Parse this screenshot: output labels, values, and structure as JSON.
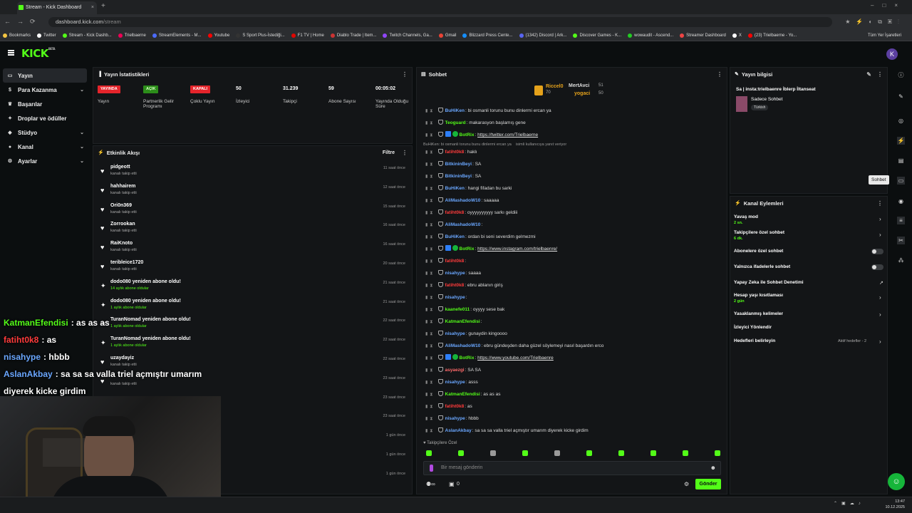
{
  "browser": {
    "tab_title": "Stream - Kick Dashboard",
    "url_domain": "dashboard.kick.com",
    "url_path": "/stream",
    "bookmarks": [
      "Bookmarks",
      "Twitter",
      "Stream - Kick Dashb...",
      "Trielbaerne",
      "StreamElements - M...",
      "Youtube",
      "S Sport Plus-İstediği...",
      "F1 TV | Home",
      "Diablo Trade | Item...",
      "Twitch Channels, Ga...",
      "Gmail",
      "Blizzard Press Cente...",
      "(1342) Discord | Ark...",
      "Discover Games - K...",
      "wowaudit - Ascend...",
      "Streamer Dashboard",
      "X",
      "(23) Trielbaerne - Yo..."
    ],
    "bookmarks_right": "Tüm Yer İşaretleri"
  },
  "app": {
    "logo": "KICK",
    "logo_sup": "BETA",
    "avatar": "K"
  },
  "sidebar": {
    "items": [
      {
        "label": "Yayın",
        "icon": "stream-icon"
      },
      {
        "label": "Para Kazanma",
        "icon": "dollar-icon"
      },
      {
        "label": "Başarılar",
        "icon": "trophy-icon"
      },
      {
        "label": "Droplar ve ödüller",
        "icon": "gift-icon"
      },
      {
        "label": "Stüdyo",
        "icon": "studio-icon"
      },
      {
        "label": "Kanal",
        "icon": "user-icon"
      },
      {
        "label": "Ayarlar",
        "icon": "gear-icon"
      }
    ]
  },
  "stats": {
    "title": "Yayın İstatistikleri",
    "items": [
      {
        "value": "YAYINDA",
        "label": "Yayın",
        "type": "badge-red"
      },
      {
        "value": "AÇIK",
        "label": "Partnerlik Gelir Programı",
        "type": "badge-green"
      },
      {
        "value": "KAPALI",
        "label": "Çoklu Yayın",
        "type": "badge-red"
      },
      {
        "value": "50",
        "label": "İzleyici"
      },
      {
        "value": "31.239",
        "label": "Takipçi"
      },
      {
        "value": "59",
        "label": "Abone Sayısı"
      },
      {
        "value": "00:05:02",
        "label": "Yayında Olduğu Süre"
      }
    ]
  },
  "events": {
    "title": "Etkinlik Akışı",
    "filter": "Filtre",
    "items": [
      {
        "name": "pidgeott",
        "sub": "kanalı takip etti",
        "time": "11 saat önce",
        "icon": "heart"
      },
      {
        "name": "hahhairem",
        "sub": "kanalı takip etti",
        "time": "12 saat önce",
        "icon": "heart"
      },
      {
        "name": "Ori0n369",
        "sub": "kanalı takip etti",
        "time": "15 saat önce",
        "icon": "heart"
      },
      {
        "name": "Zorrookan",
        "sub": "kanalı takip etti",
        "time": "16 saat önce",
        "icon": "heart"
      },
      {
        "name": "RaiKnoto",
        "sub": "kanalı takip etti",
        "time": "16 saat önce",
        "icon": "heart"
      },
      {
        "name": "teribleice1720",
        "sub": "kanalı takip etti",
        "time": "20 saat önce",
        "icon": "heart"
      },
      {
        "name": "dodo080 yeniden abone oldu!",
        "sub": "14 aylık abone oldular",
        "time": "21 saat önce",
        "icon": "star"
      },
      {
        "name": "dodo080 yeniden abone oldu!",
        "sub": "1 aylık abone oldular",
        "time": "21 saat önce",
        "icon": "star"
      },
      {
        "name": "TuranNomad yeniden abone oldu!",
        "sub": "1 aylık abone oldular",
        "time": "22 saat önce",
        "icon": "star"
      },
      {
        "name": "TuranNomad yeniden abone oldu!",
        "sub": "1 aylık abone oldular",
        "time": "22 saat önce",
        "icon": "star"
      },
      {
        "name": "uzaydayiz",
        "sub": "kanalı takip etti",
        "time": "22 saat önce",
        "icon": "heart"
      },
      {
        "name": "",
        "sub": "kanalı takip etti",
        "time": "23 saat önce",
        "icon": "heart"
      },
      {
        "name": "",
        "sub": "",
        "time": "23 saat önce",
        "icon": "star"
      },
      {
        "name": "",
        "sub": "",
        "time": "23 saat önce",
        "icon": "heart"
      },
      {
        "name": "",
        "sub": "",
        "time": "1 gün önce",
        "icon": "heart"
      },
      {
        "name": "",
        "sub": "",
        "time": "1 gün önce",
        "icon": "heart"
      },
      {
        "name": "",
        "sub": "",
        "time": "1 gün önce",
        "icon": "heart"
      }
    ]
  },
  "chat": {
    "title": "Sohbet",
    "top": [
      {
        "name": "Riccel0",
        "count": "70"
      },
      {
        "name": "MertAvci",
        "count": "51"
      },
      {
        "name": "yogaci",
        "count": "50"
      }
    ],
    "reply_hint": "BuHiKen: bi osmanli torunu bunu dinlermi ercan ya",
    "reply_hint_suffix": "isimli kullanıcıya yanıt veriyor",
    "messages": [
      {
        "user": "BuHiKen",
        "color": "#6aa7ff",
        "text": "bi osmanli torunu bunu dinlermi ercan ya"
      },
      {
        "user": "Teoguard",
        "color": "#53fc18",
        "text": "makarasyon başlamış gene"
      },
      {
        "user": "BotRix",
        "color": "#53fc18",
        "text": "",
        "link": "https://twitter.com/Trielbaerne",
        "bot": true
      },
      {
        "user": "fatiht0k8",
        "color": "#ff3b3b",
        "text": "haklı"
      },
      {
        "user": "BitkininBeyi",
        "color": "#6aa7ff",
        "text": "SA"
      },
      {
        "user": "BitkininBeyi",
        "color": "#6aa7ff",
        "text": "SA"
      },
      {
        "user": "BuHiKen",
        "color": "#6aa7ff",
        "text": "hangi fifadan bu sarki"
      },
      {
        "user": "AliMashadoW10",
        "color": "#6aa7ff",
        "text": "saaaaa"
      },
      {
        "user": "fatiht0k8",
        "color": "#ff3b3b",
        "text": "oyyyyyyyyyy sarkı geldiii"
      },
      {
        "user": "AliMashadoW10",
        "color": "#6aa7ff",
        "text": ""
      },
      {
        "user": "BuHiKen",
        "color": "#6aa7ff",
        "text": "ordan bi seni severdim gelmezmi"
      },
      {
        "user": "BotRix",
        "color": "#53fc18",
        "text": "",
        "link": "https://www.instagram.com/trielbaenre/",
        "bot": true
      },
      {
        "user": "fatiht0k8",
        "color": "#ff3b3b",
        "text": ""
      },
      {
        "user": "nisahype",
        "color": "#6aa7ff",
        "text": "saaaa"
      },
      {
        "user": "fatiht0k8",
        "color": "#ff3b3b",
        "text": "ebru ablanın giriş"
      },
      {
        "user": "nisahype",
        "color": "#6aa7ff",
        "text": ""
      },
      {
        "user": "kaanefe011",
        "color": "#53fc18",
        "text": "oyyyy sese bak"
      },
      {
        "user": "KatmanEfendisi",
        "color": "#53fc18",
        "text": ""
      },
      {
        "user": "nisahype",
        "color": "#6aa7ff",
        "text": "gunaydin kingoooo"
      },
      {
        "user": "AliMashadoW10",
        "color": "#6aa7ff",
        "text": "ebru gündeşden daha güzel söylemeyi nasıl başardın erco"
      },
      {
        "user": "BotRix",
        "color": "#53fc18",
        "text": "",
        "link": "https://www.youtube.com/Trielbaenre",
        "bot": true
      },
      {
        "user": "asyaezgi",
        "color": "#ff6a6a",
        "text": "SA SA"
      },
      {
        "user": "nisahype",
        "color": "#6aa7ff",
        "text": "asss"
      },
      {
        "user": "KatmanEfendisi",
        "color": "#53fc18",
        "text": "as as as"
      },
      {
        "user": "fatiht0k8",
        "color": "#ff3b3b",
        "text": "as"
      },
      {
        "user": "nisahype",
        "color": "#6aa7ff",
        "text": "hbbb"
      },
      {
        "user": "AslanAkbay",
        "color": "#6aa7ff",
        "text": "sa sa sa valla triel açmıştır umarım diyerek kicke girdim"
      }
    ],
    "followers_only": "Takipçilere Özel",
    "input_placeholder": "Bir mesaj gönderin",
    "send": "Gönder",
    "viewer_count": "0"
  },
  "info": {
    "title": "Yayın bilgisi",
    "stream_title": "Sa | insta:trielbaenre İblerp İltanseat",
    "category": "Sadece Sohbet",
    "tag": "Türkish"
  },
  "actions": {
    "title": "Kanal Eylemleri",
    "items": [
      {
        "label": "Yavaş mod",
        "sub": "2 sn.",
        "ctrl": "chevron"
      },
      {
        "label": "Takipçilere özel sohbet",
        "sub": "6 dk.",
        "ctrl": "chevron"
      },
      {
        "label": "Abonelere özel sohbet",
        "sub": "",
        "ctrl": "toggle"
      },
      {
        "label": "Yalnızca ifadelerle sohbet",
        "sub": "",
        "ctrl": "toggle"
      },
      {
        "label": "Yapay Zeka ile Sohbet Denetimi",
        "sub": "",
        "ctrl": "external"
      },
      {
        "label": "Hesap yaşı kısıtlaması",
        "sub": "2 gün",
        "ctrl": "chevron"
      },
      {
        "label": "Yasaklanmış kelimeler",
        "sub": "",
        "ctrl": "chevron"
      },
      {
        "label": "İzleyici Yönlendir",
        "sub": "",
        "ctrl": "none"
      },
      {
        "label": "Hedefleri belirleyin",
        "sub": "",
        "ctrl": "chevron",
        "right_text": "Aktif hedefler - 2"
      }
    ]
  },
  "tooltip": "Sohbet",
  "overlay_chat": [
    {
      "user": "KatmanEfendisi",
      "color": "#53fc18",
      "text": ": as as as"
    },
    {
      "user": "fatiht0k8",
      "color": "#ff3b3b",
      "text": ": as"
    },
    {
      "user": "nisahype",
      "color": "#6aa7ff",
      "text": ": hbbb"
    },
    {
      "user": "AslanAkbay",
      "color": "#6aa7ff",
      "text": ": sa sa sa valla triel açmıştır umarım"
    },
    {
      "user": "",
      "color": "#ffffff",
      "text": "diyerek kicke girdim"
    }
  ],
  "taskbar": {
    "time": "13:47",
    "date": "10.12.2025"
  },
  "colors": {
    "accent": "#53fc18",
    "live": "#e5242b",
    "panel": "#131517"
  }
}
